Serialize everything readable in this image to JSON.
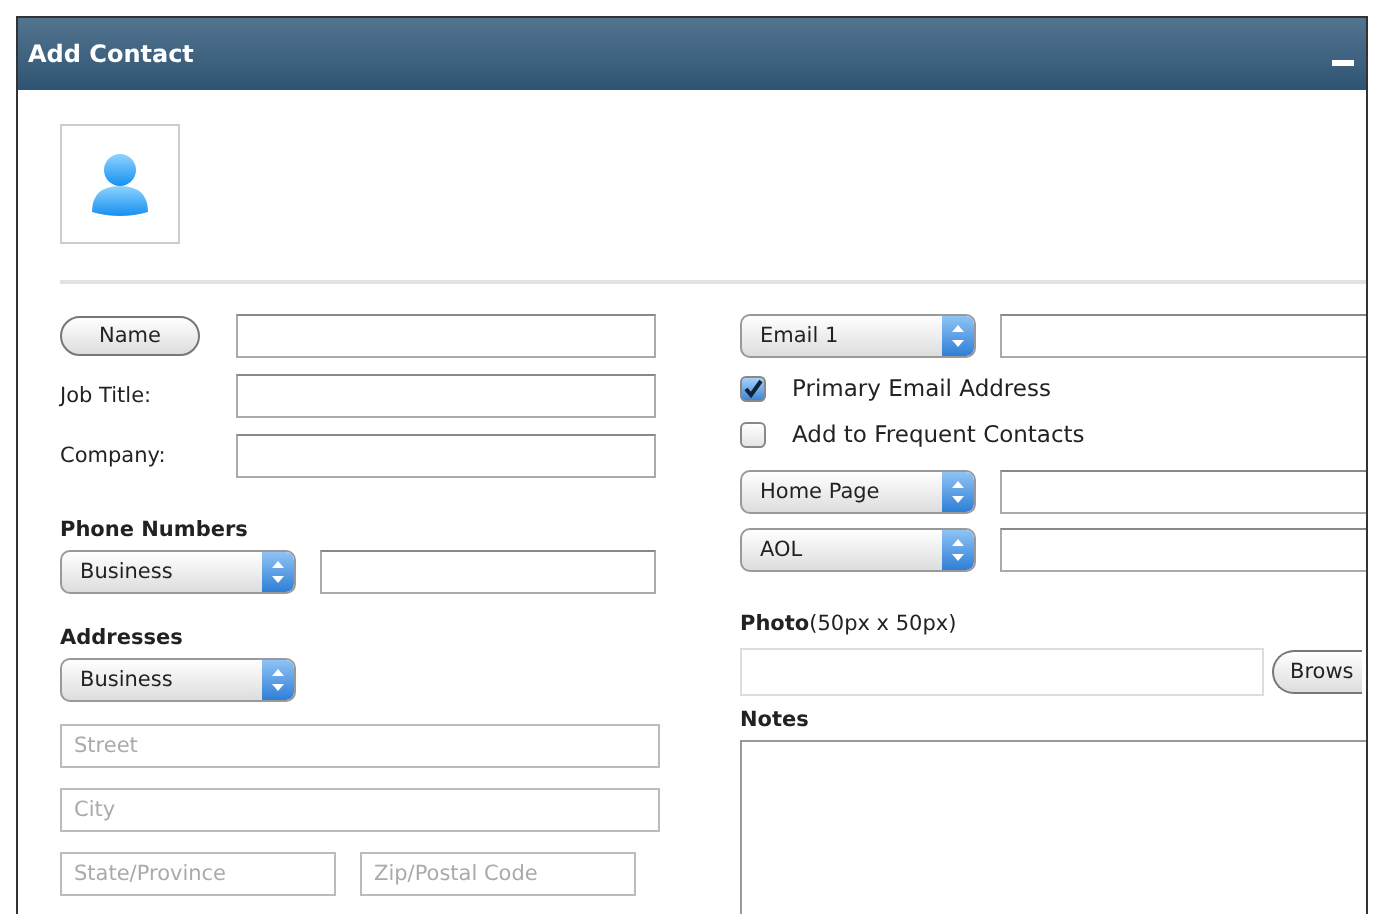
{
  "window": {
    "title": "Add Contact"
  },
  "name_button": "Name",
  "fields": [
    {
      "label": "Job Title:"
    },
    {
      "label": "Company:"
    }
  ],
  "phone": {
    "heading": "Phone Numbers",
    "type": "Business"
  },
  "addresses": {
    "heading": "Addresses",
    "type": "Business",
    "fields": [
      {
        "placeholder": "Street"
      },
      {
        "placeholder": "City"
      }
    ],
    "last_row": [
      {
        "placeholder": "State/Province"
      },
      {
        "placeholder": "Zip/Postal Code"
      }
    ]
  },
  "email": {
    "type": "Email 1"
  },
  "options": [
    {
      "label": "Primary Email Address",
      "checked": true
    },
    {
      "label": "Add to Frequent Contacts",
      "checked": false
    }
  ],
  "web": [
    {
      "type": "Home Page"
    },
    {
      "type": "AOL"
    }
  ],
  "photo": {
    "label": "**Photo**(50px x 50px)",
    "button": "Brows"
  },
  "notes": {
    "label": "Notes"
  }
}
